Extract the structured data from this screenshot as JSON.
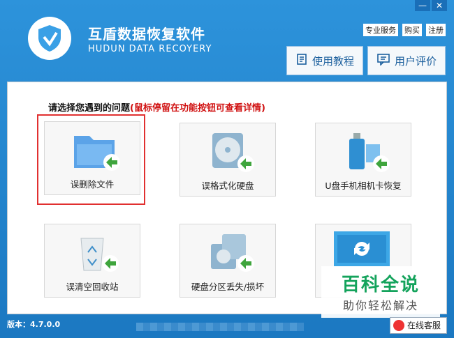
{
  "app": {
    "title_cn": "互盾数据恢复软件",
    "title_en": "HUDUN DATA RECOYERY",
    "window_buttons": [
      "—",
      "✕"
    ]
  },
  "top_links": [
    "专业服务",
    "购买",
    "注册"
  ],
  "nav": {
    "tutorial": "使用教程",
    "review": "用户评价"
  },
  "prompt": {
    "main": "请选择您遇到的问题",
    "hint": "(鼠标停留在功能按钮可查看详情)"
  },
  "tiles": [
    {
      "label": "误删除文件",
      "icon": "folder-restore-icon"
    },
    {
      "label": "误格式化硬盘",
      "icon": "disk-format-icon"
    },
    {
      "label": "U盘手机相机卡恢复",
      "icon": "usb-card-icon"
    },
    {
      "label": "误清空回收站",
      "icon": "recycle-bin-icon"
    },
    {
      "label": "硬盘分区丢失/损坏",
      "icon": "partition-icon"
    },
    {
      "label": "",
      "icon": "refresh-icon"
    }
  ],
  "watermark": {
    "line1": "百科全说",
    "line2": "助你轻松解决"
  },
  "status": {
    "version": "版本：4.7.0.0",
    "support": "在线客服"
  },
  "colors": {
    "header": "#2d93db",
    "accent_red": "#e13030",
    "watermark_green": "#14a35c"
  }
}
